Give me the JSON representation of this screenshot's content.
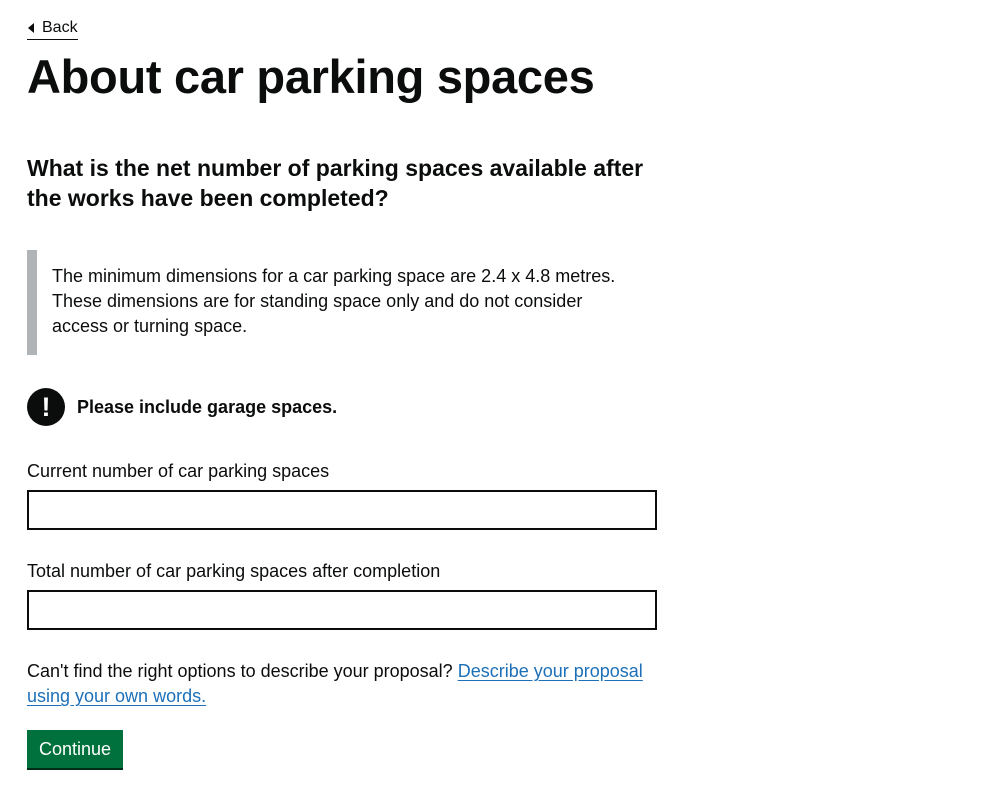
{
  "back": {
    "label": "Back",
    "icon": "caret-left-icon"
  },
  "page": {
    "title": "About car parking spaces"
  },
  "question": {
    "text": "What is the net number of parking spaces available after the works have been completed?"
  },
  "inset": {
    "text": "The minimum dimensions for a car parking space are 2.4 x 4.8 metres. These dimensions are for standing space only and do not consider access or turning space."
  },
  "warning": {
    "icon_symbol": "!",
    "icon": "exclamation-icon",
    "text": "Please include garage spaces."
  },
  "fields": {
    "current": {
      "label": "Current number of car parking spaces",
      "value": ""
    },
    "total": {
      "label": "Total number of car parking spaces after completion",
      "value": ""
    }
  },
  "help": {
    "text": "Can't find the right options to describe your proposal? ",
    "link_label": "Describe your proposal using your own words."
  },
  "buttons": {
    "continue_label": "Continue"
  },
  "colors": {
    "text": "#0b0c0c",
    "link": "#1d70b8",
    "button": "#00703c",
    "inset_border": "#b1b4b6"
  }
}
